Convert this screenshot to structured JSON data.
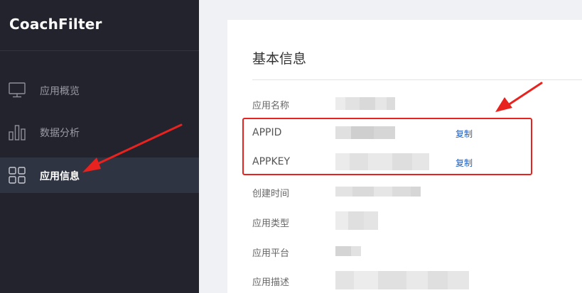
{
  "app": {
    "title": "CoachFilter"
  },
  "sidebar": {
    "items": [
      {
        "label": "应用概览",
        "icon": "monitor-icon",
        "active": false
      },
      {
        "label": "数据分析",
        "icon": "bar-chart-icon",
        "active": false
      },
      {
        "label": "应用信息",
        "icon": "grid-icon",
        "active": true
      }
    ]
  },
  "main": {
    "section_title": "基本信息",
    "fields": [
      {
        "key": "应用名称",
        "value": "(blurred)"
      },
      {
        "key": "APPID",
        "value": "(blurred)",
        "action": "复制"
      },
      {
        "key": "APPKEY",
        "value": "(blurred)",
        "action": "复制"
      },
      {
        "key": "创建时间",
        "value": "(blurred)"
      },
      {
        "key": "应用类型",
        "value": "(blurred)"
      },
      {
        "key": "应用平台",
        "value": "(blurred)"
      },
      {
        "key": "应用描述",
        "value": "(blurred)"
      }
    ]
  },
  "colors": {
    "annotation": "#e8231f",
    "link": "#1e5fbf",
    "sidebar_bg": "#22232d",
    "active_bg": "#2f3442"
  }
}
